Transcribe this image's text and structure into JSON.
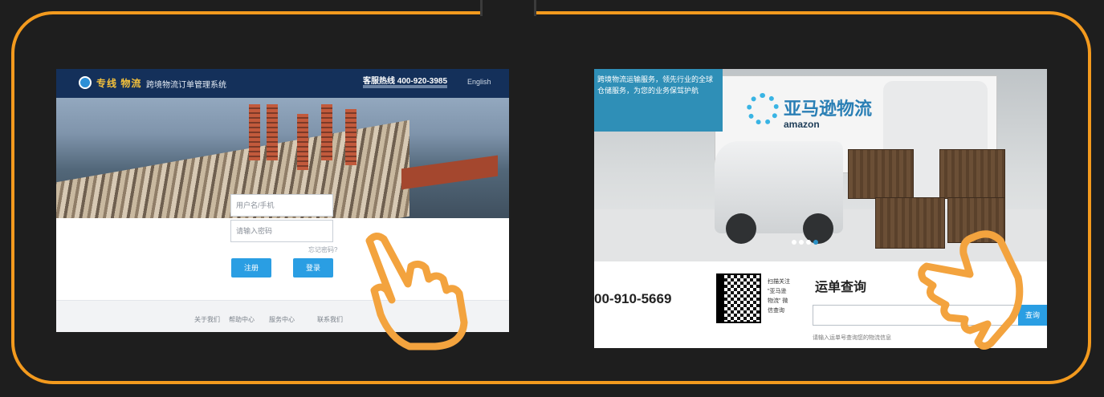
{
  "colors": {
    "frame": "#f39a1e",
    "background": "#1e1e1e",
    "accent": "#2a9ee3",
    "hand": "#f3a33e"
  },
  "left_site": {
    "brand": "专线 物流",
    "title": "跨境物流订单管理系统",
    "hotline": "客服热线 400-920-3985",
    "lang": "English",
    "username_placeholder": "用户名/手机",
    "password_placeholder": "请输入密码",
    "forgot_link": "忘记密码?",
    "register_button": "注册",
    "login_button": "登录",
    "footer_links": [
      "关于我们",
      "帮助中心",
      "服务中心",
      "联系我们"
    ]
  },
  "right_site": {
    "banner_text": "跨境物流运输服务，领先行业的全球仓储服务，为您的业务保驾护航",
    "logo_cn": "亚马逊物流",
    "logo_en": "amazon",
    "phone": "00-910-5669",
    "qr_caption": "扫描关注 \"亚马逊 物流\" 微信查询",
    "track_title": "运单查询",
    "track_button": "查询",
    "track_hint": "请输入运单号查询您的物流信息"
  },
  "icons": [
    "hand-pointer-icon",
    "hand-pointer-icon"
  ]
}
